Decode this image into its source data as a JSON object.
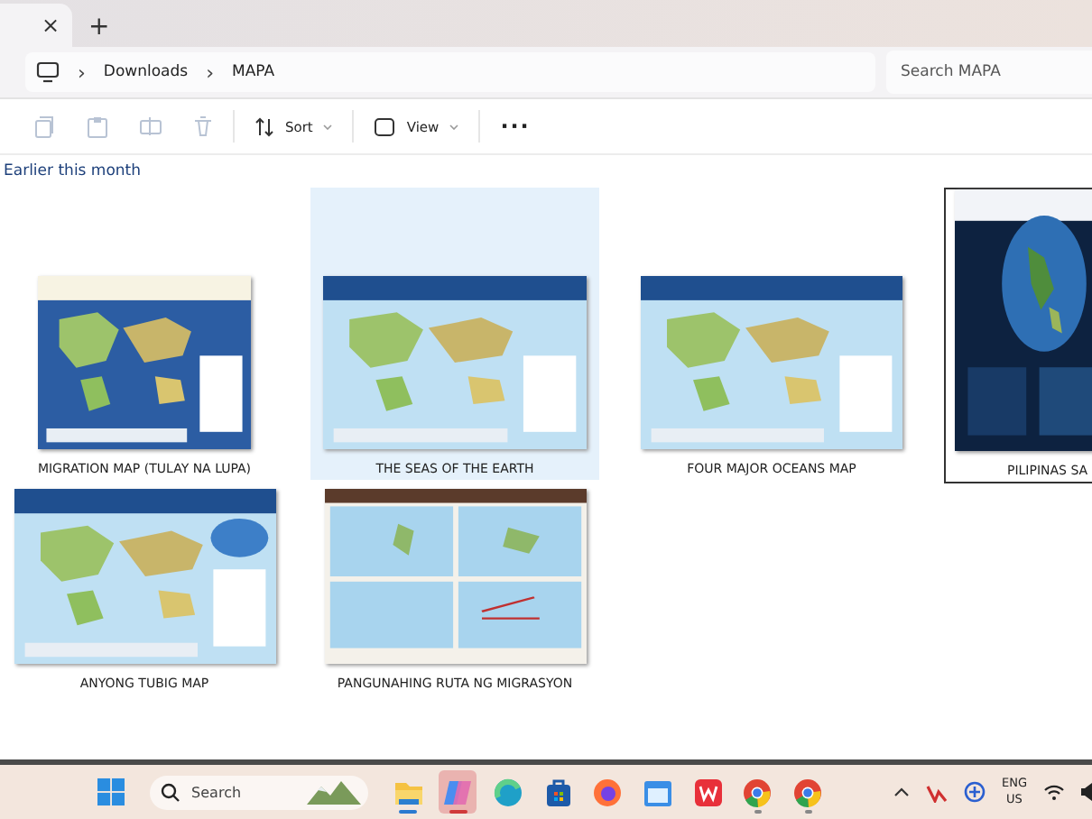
{
  "tab": {
    "close": "×",
    "new_tab": "+"
  },
  "address": {
    "separator": "›",
    "crumbs": [
      "Downloads",
      "MAPA"
    ]
  },
  "search": {
    "placeholder": "Search MAPA"
  },
  "toolbar": {
    "sort": "Sort",
    "view": "View",
    "more": "···"
  },
  "group_heading": "Earlier this month",
  "files": [
    {
      "name": "MIGRATION MAP (TULAY NA LUPA)",
      "selected": false
    },
    {
      "name": "THE SEAS OF THE EARTH",
      "selected": true
    },
    {
      "name": "FOUR MAJOR OCEANS MAP",
      "selected": false
    },
    {
      "name": "PILIPINAS SA",
      "selected": false
    },
    {
      "name": "ANYONG TUBIG MAP",
      "selected": false
    },
    {
      "name": "PANGUNAHING RUTA NG MIGRASYON",
      "selected": false
    }
  ],
  "taskbar": {
    "search_placeholder": "Search",
    "apps": [
      {
        "kind": "folder",
        "running": true,
        "selected": false
      },
      {
        "kind": "copilot",
        "running": true,
        "selected": true
      },
      {
        "kind": "edge",
        "running": false,
        "selected": false
      },
      {
        "kind": "store",
        "running": false,
        "selected": false
      },
      {
        "kind": "firefox",
        "running": false,
        "selected": false
      },
      {
        "kind": "calendar",
        "running": false,
        "selected": false
      },
      {
        "kind": "office",
        "running": false,
        "selected": false
      },
      {
        "kind": "chrome",
        "running": true,
        "selected": false
      },
      {
        "kind": "chrome",
        "running": true,
        "selected": false
      }
    ],
    "language": "ENG",
    "region": "US"
  }
}
